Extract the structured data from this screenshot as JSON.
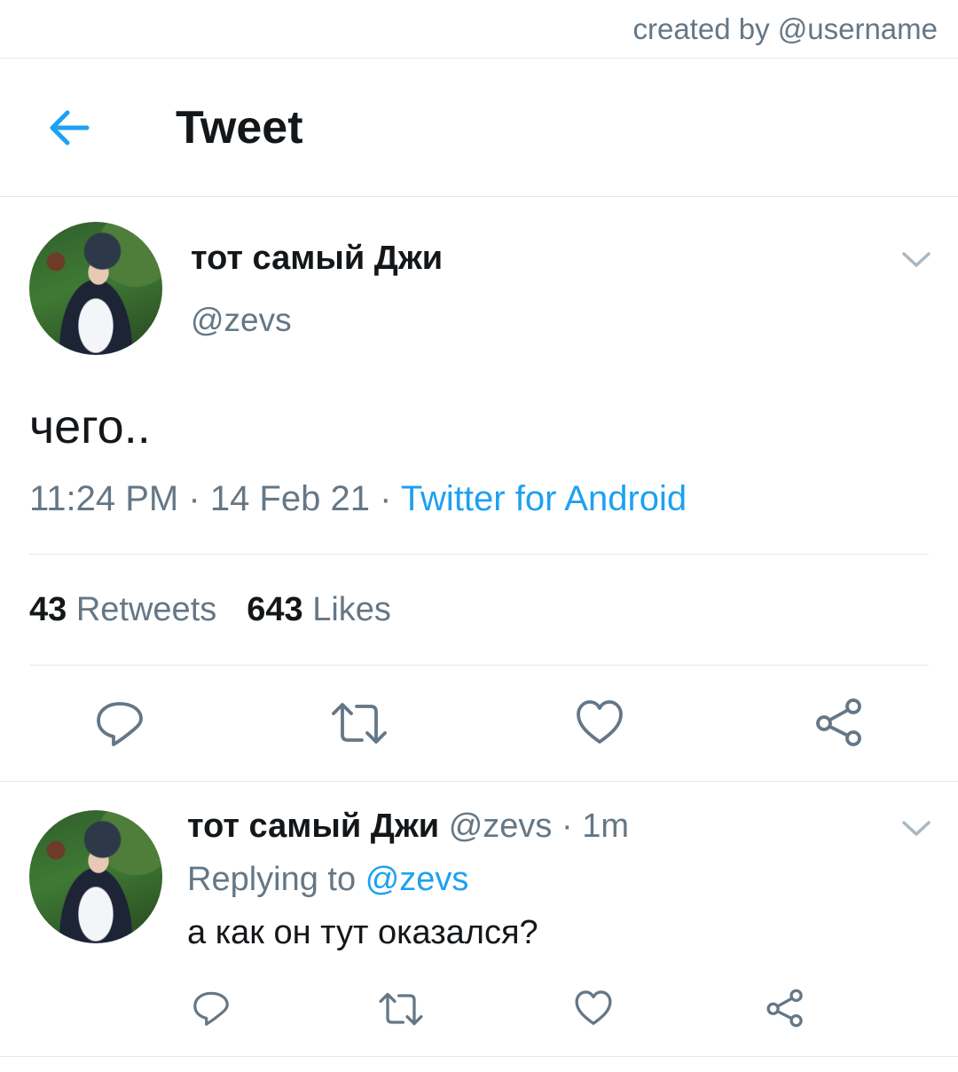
{
  "credit": "created by @username",
  "header": {
    "title": "Tweet",
    "back_icon": "arrow-left-icon"
  },
  "colors": {
    "accent": "#1da1f2",
    "muted": "#657786",
    "text": "#14171a",
    "divider": "#e1e8ed"
  },
  "tweet": {
    "name": "тот самый Джи",
    "handle": "@zevs",
    "text": "чего..",
    "time": "11:24 PM",
    "date": "14 Feb 21",
    "source": "Twitter for Android",
    "sep": "·",
    "retweets_count": "43",
    "retweets_label": "Retweets",
    "likes_count": "643",
    "likes_label": "Likes"
  },
  "reply": {
    "name": "тот самый Джи",
    "handle": "@zevs",
    "time": "1m",
    "replying_label": "Replying to",
    "replying_to": "@zevs",
    "text": "а как он тут оказался?"
  },
  "actions": [
    "reply-icon",
    "retweet-icon",
    "like-icon",
    "share-icon"
  ]
}
